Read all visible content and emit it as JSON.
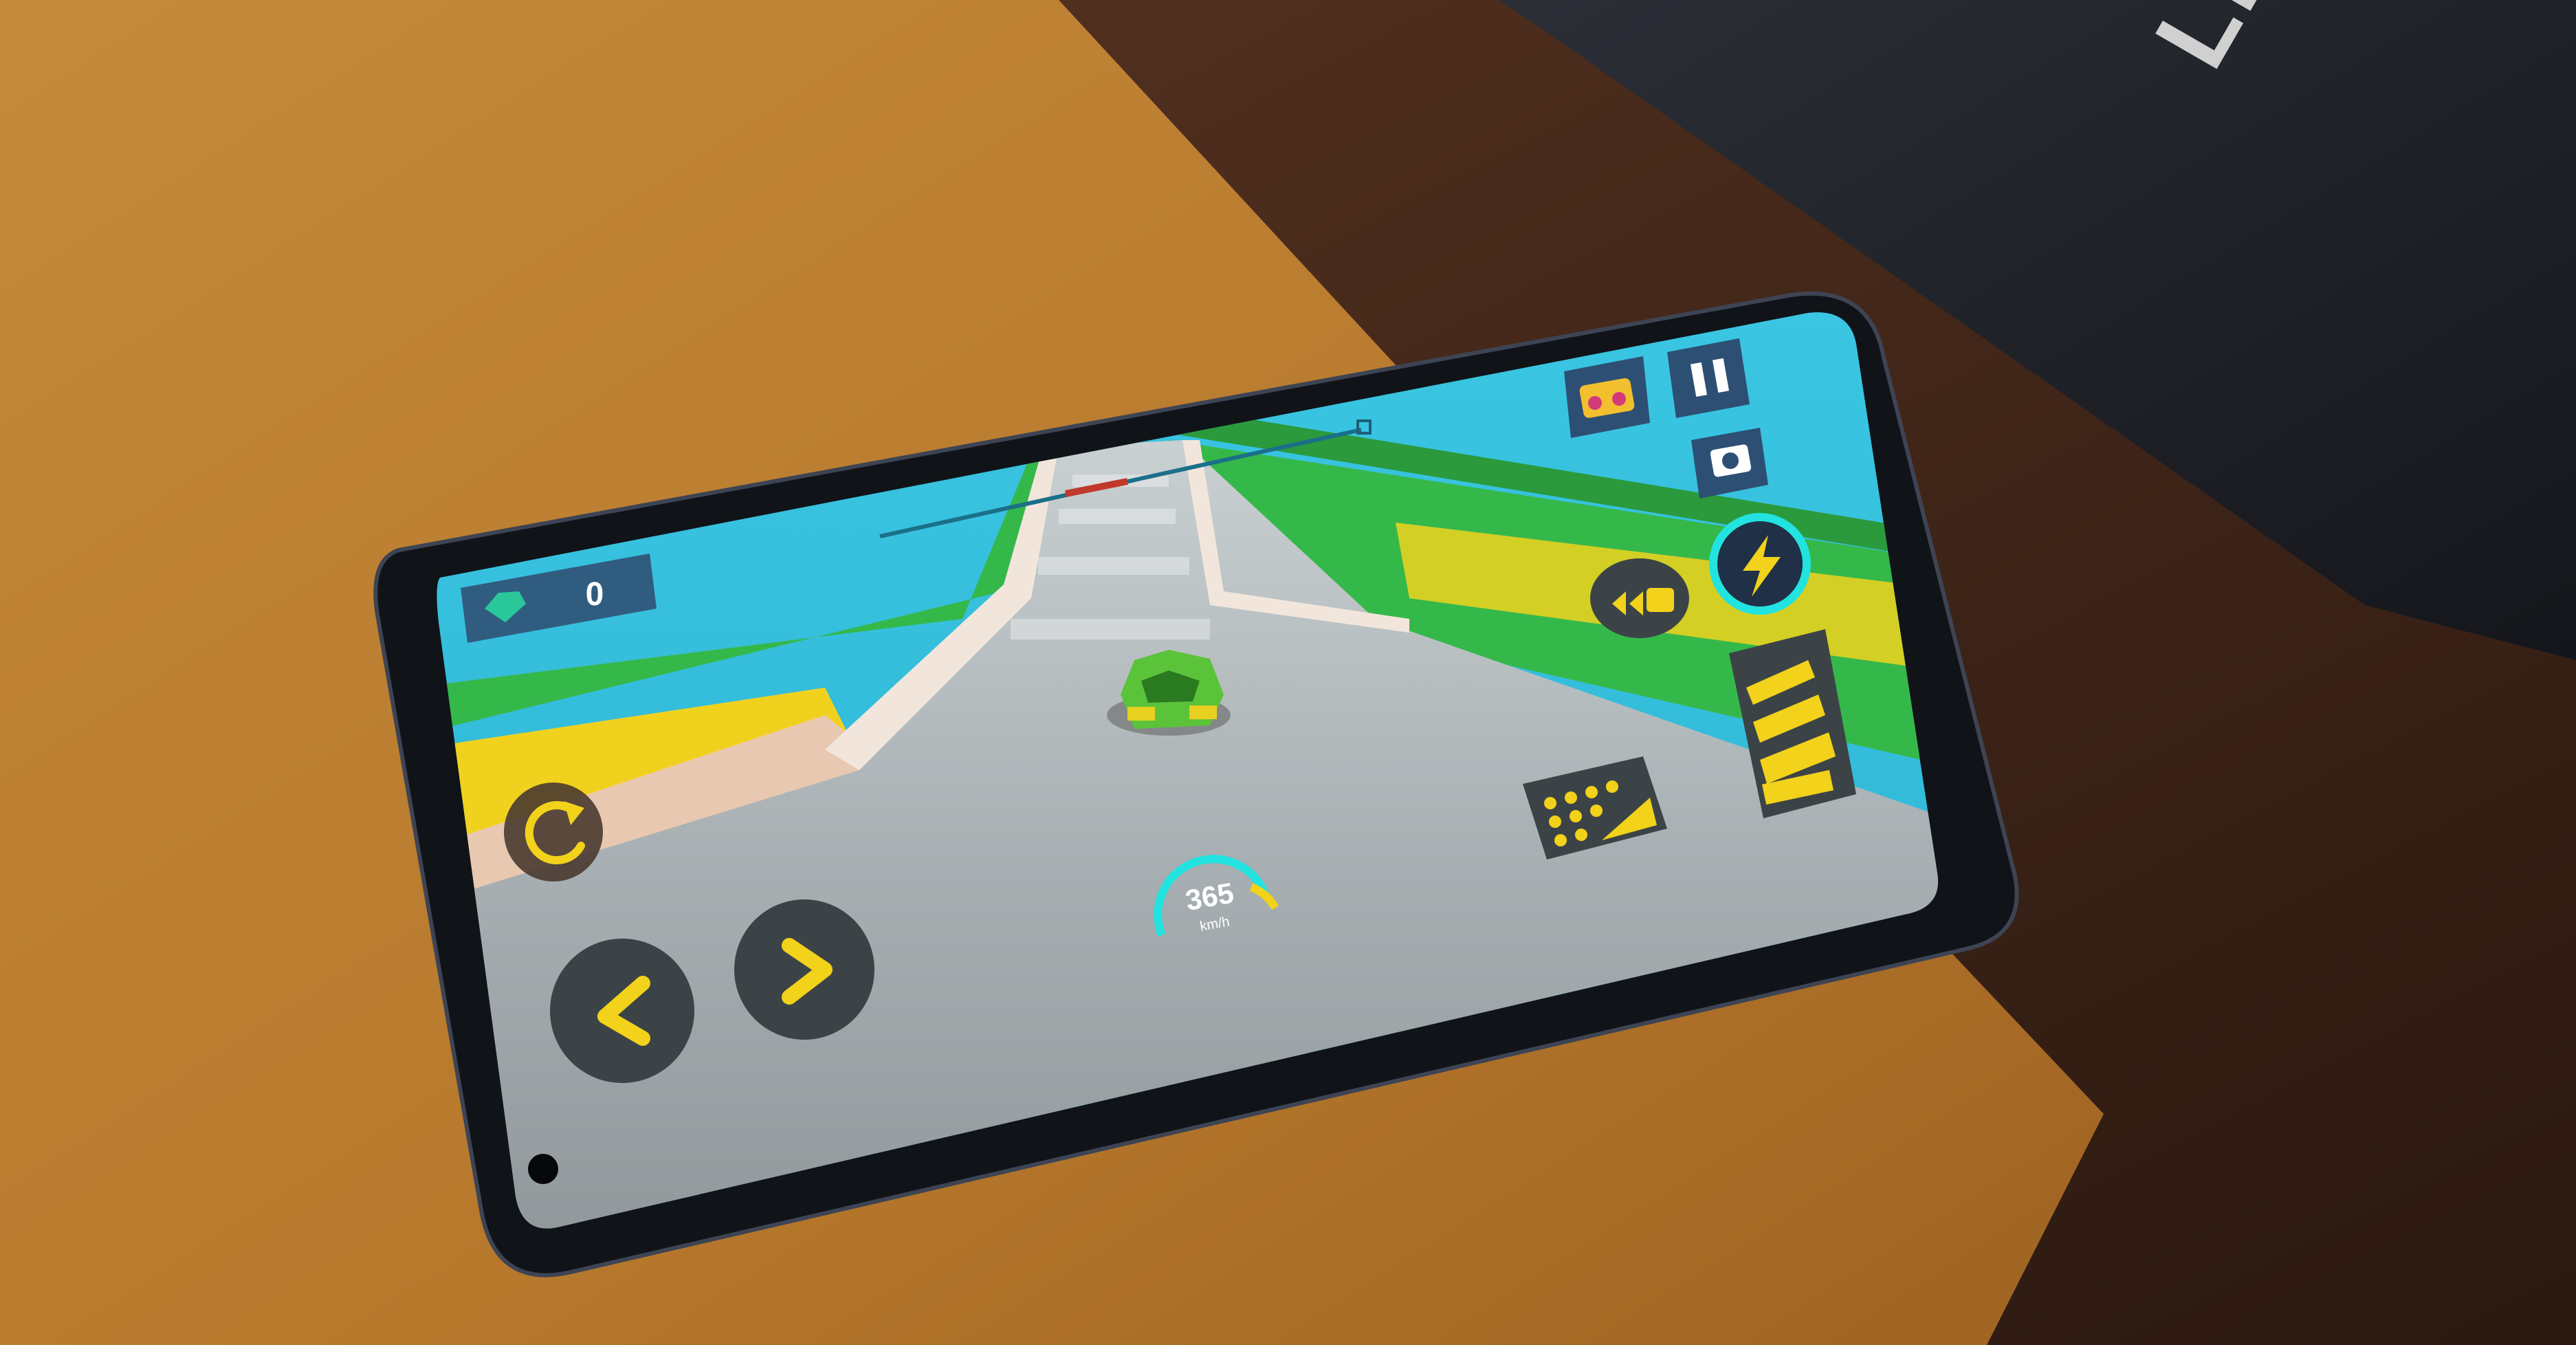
{
  "game": {
    "gem_count": "0",
    "speed_value": "365",
    "speed_unit": "km/h"
  },
  "background": {
    "box_brand_fragment": "LENOVO"
  },
  "controls": {
    "restart_icon": "restart-icon",
    "steer_left_icon": "chevron-left-icon",
    "steer_right_icon": "chevron-right-icon",
    "brake_icon": "brake-pedal-icon",
    "gas_icon": "gas-pedal-icon",
    "nitro_icon": "lightning-icon",
    "camera_icon": "camera-icon",
    "pause_icon": "pause-icon",
    "shop_icon": "chest-icon",
    "rewind_icon": "rewind-car-icon"
  },
  "colors": {
    "sky": "#2ec0dc",
    "road": "#9aa3a6",
    "ramp_yellow": "#f0d21e",
    "ramp_green": "#35b84a",
    "ui_yellow": "#f2d21a",
    "ui_dark": "#3c4347",
    "nitro_ring": "#22e3e0"
  }
}
